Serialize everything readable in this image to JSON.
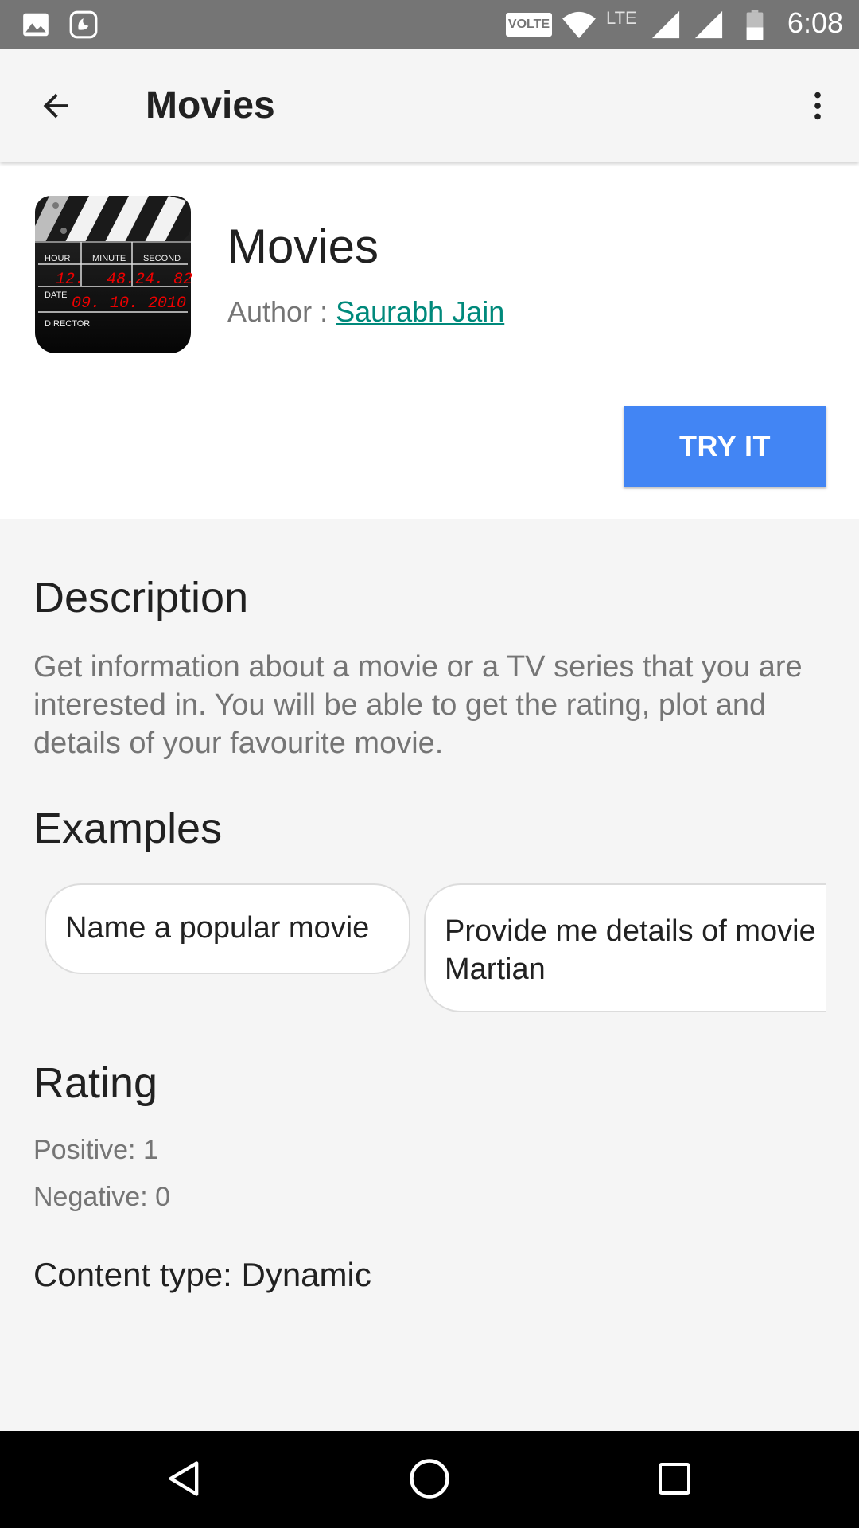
{
  "status_bar": {
    "time": "6:08",
    "volte_label": "VOLTE",
    "lte_label": "LTE",
    "icons": [
      "gallery-icon",
      "saavn-icon",
      "volte-icon",
      "wifi-icon",
      "lte-signal-icon",
      "signal-icon",
      "battery-icon"
    ]
  },
  "app_bar": {
    "title": "Movies",
    "back_icon": "arrow-back-icon",
    "more_icon": "more-vert-icon"
  },
  "header": {
    "app_name": "Movies",
    "author_prefix": "Author : ",
    "author_name": "Saurabh Jain",
    "try_button": "TRY IT",
    "app_icon": {
      "name": "clapperboard-icon",
      "labels": {
        "hour": "HOUR",
        "minute": "MINUTE",
        "second": "SECOND",
        "date": "DATE",
        "director": "DIRECTOR",
        "time_digits_1": "12.",
        "time_digits_2": "48.",
        "time_digits_3": "24. 82",
        "date_digits": "09. 10. 2010"
      }
    }
  },
  "description": {
    "title": "Description",
    "text": "Get information about a movie or a TV series that you are interested in. You will be able to get the rating, plot and details of your favourite movie."
  },
  "examples": {
    "title": "Examples",
    "items": [
      {
        "line1": "Name a popular movie",
        "line2": ""
      },
      {
        "line1": "Provide me details of movie",
        "line2": "Martian"
      }
    ]
  },
  "rating": {
    "title": "Rating",
    "positive": "Positive: 1",
    "negative": "Negative: 0"
  },
  "content_type": "Content type: Dynamic",
  "colors": {
    "accent": "#4285f4",
    "link": "#00897b",
    "status_bar": "#757575",
    "background": "#f5f5f5"
  },
  "nav_bar": {
    "icons": [
      "back-triangle-icon",
      "home-circle-icon",
      "recents-square-icon"
    ]
  }
}
